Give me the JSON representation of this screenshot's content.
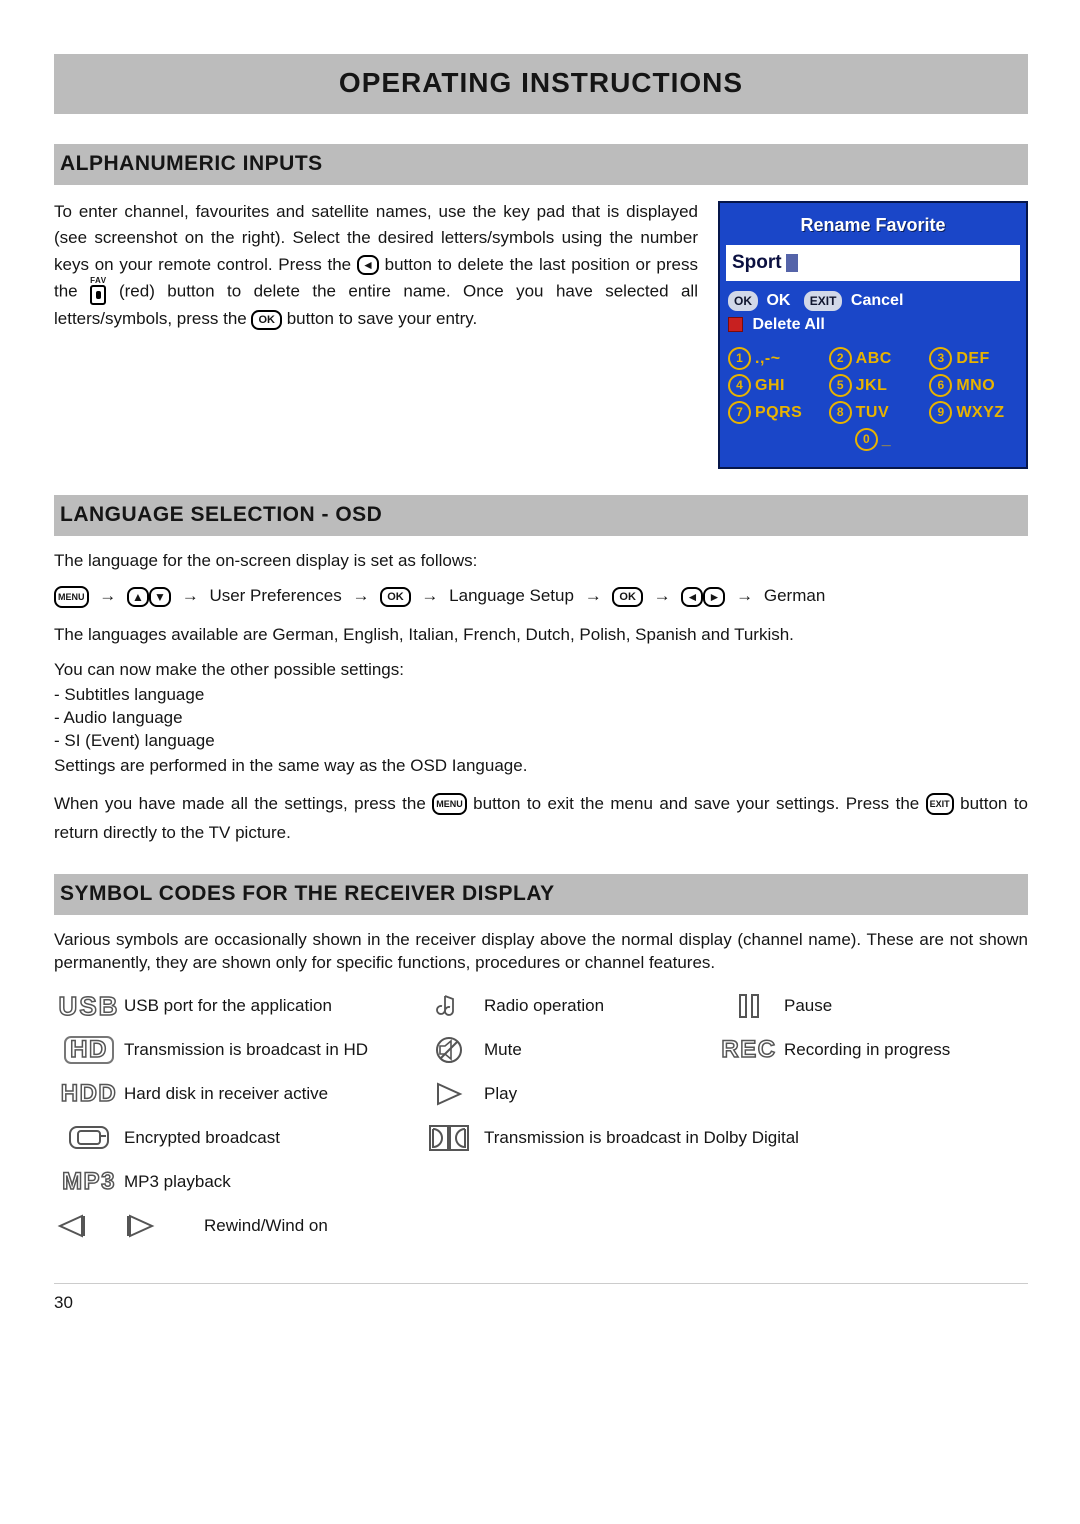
{
  "title": "OPERATING INSTRUCTIONS",
  "sections": {
    "alpha": {
      "heading": "ALPHANUMERIC INPUTS",
      "text_a": "To enter channel, favourites and satellite names, use the key pad that is displayed (see screenshot on the right). Select the desired letters/symbols using the number keys on your remote control. Press the ",
      "text_b": " button to delete the last position or press the ",
      "text_c": "(red) button to delete the entire name. Once you have selected all letters/symbols, press the ",
      "text_d": " button to save your entry."
    },
    "lang": {
      "heading": "LANGUAGE SELECTION - OSD",
      "intro": "The language for the on-screen display is set as follows:",
      "flow": {
        "user_pref": "User Preferences",
        "lang_setup": "Language Setup",
        "german": "German"
      },
      "available": "The languages available are German, English, Italian, French, Dutch, Polish, Spanish and Turkish.",
      "settings_intro": "You can now make the other possible settings:",
      "settings": [
        "- Subtitles language",
        "- Audio Ianguage",
        "- SI (Event) language"
      ],
      "settings_same": "Settings are performed in the same way as the OSD Ianguage.",
      "exit_a": "When you have made all the settings, press the ",
      "exit_b": " button to exit the menu and save your settings. Press the ",
      "exit_c": " button to return directly to the TV picture."
    },
    "symbols": {
      "heading": "SYMBOL CODES FOR THE RECEIVER DISPLAY",
      "intro": "Various symbols are occasionally shown in the receiver display above the normal display (channel name). These are not shown permanently, they are shown only for specific functions, procedures or channel features.",
      "usb": "USB port for the application",
      "hd": "Transmission is broadcast in HD",
      "hdd": "Hard disk in receiver active",
      "encrypted": "Encrypted broadcast",
      "mp3": "MP3 playback",
      "radio": "Radio operation",
      "mute": "Mute",
      "play": "Play",
      "dolby": "Transmission is broadcast in Dolby Digital",
      "rewind": "Rewind/Wind on",
      "pause": "Pause",
      "rec": "Recording in progress"
    }
  },
  "buttons": {
    "left_arrow": "◄",
    "right_arrow": "►",
    "up_arrow": "▲",
    "down_arrow": "▼",
    "ok": "OK",
    "menu": "MENU",
    "exit": "EXIT",
    "fav": "FAV"
  },
  "osd": {
    "title": "Rename Favorite",
    "input_value": "Sport",
    "ok_pill": "OK",
    "ok_label": "OK",
    "exit_pill": "EXIT",
    "cancel_label": "Cancel",
    "delete_all": "Delete All",
    "keypad": [
      {
        "n": "1",
        "l": ".,-~"
      },
      {
        "n": "2",
        "l": "ABC"
      },
      {
        "n": "3",
        "l": "DEF"
      },
      {
        "n": "4",
        "l": "GHI"
      },
      {
        "n": "5",
        "l": "JKL"
      },
      {
        "n": "6",
        "l": "MNO"
      },
      {
        "n": "7",
        "l": "PQRS"
      },
      {
        "n": "8",
        "l": "TUV"
      },
      {
        "n": "9",
        "l": "WXYZ"
      },
      {
        "n": "0",
        "l": "_"
      }
    ]
  },
  "icons": {
    "usb": "USB",
    "hd": "HD",
    "hdd": "HDD",
    "mp3": "MP3",
    "rec": "REC"
  },
  "page_number": "30"
}
